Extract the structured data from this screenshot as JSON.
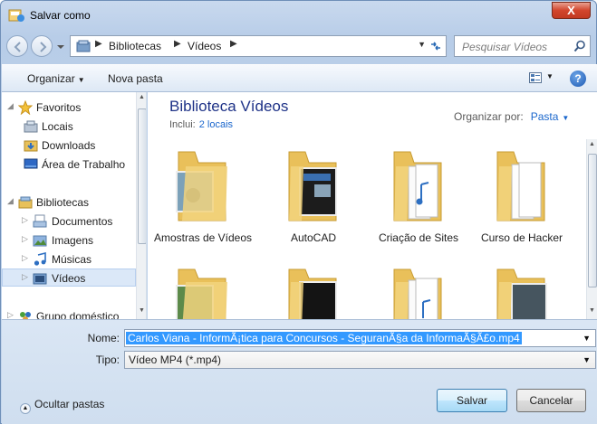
{
  "window": {
    "title": "Salvar como",
    "close_label": "X"
  },
  "address": {
    "crumbs": [
      "Bibliotecas",
      "Vídeos"
    ],
    "search_placeholder": "Pesquisar Vídeos"
  },
  "toolbar": {
    "organize": "Organizar",
    "new_folder": "Nova pasta",
    "help": "?"
  },
  "nav": {
    "favorites": "Favoritos",
    "favorites_items": [
      "Locais",
      "Downloads",
      "Área de Trabalho"
    ],
    "libraries": "Bibliotecas",
    "libraries_items": [
      "Documentos",
      "Imagens",
      "Músicas",
      "Vídeos"
    ],
    "homegroup": "Grupo doméstico"
  },
  "content": {
    "title": "Biblioteca Vídeos",
    "includes_label": "Inclui:",
    "includes_link": "2 locais",
    "arrange_label": "Organizar por:",
    "arrange_value": "Pasta",
    "folders": [
      "Amostras de Vídeos",
      "AutoCAD",
      "Criação de Sites",
      "Curso de Hacker"
    ]
  },
  "form": {
    "name_label": "Nome:",
    "name_value": "Carlos Viana - InformÃ¡tica para Concursos - SeguranÃ§a da InformaÃ§Ã£o.mp4",
    "type_label": "Tipo:",
    "type_value": "Vídeo MP4 (*.mp4)"
  },
  "footer": {
    "hide_folders": "Ocultar pastas",
    "save": "Salvar",
    "cancel": "Cancelar"
  },
  "colors": {
    "accent": "#1a66cc",
    "title_blue": "#1e3287",
    "selection": "#3399ff"
  }
}
